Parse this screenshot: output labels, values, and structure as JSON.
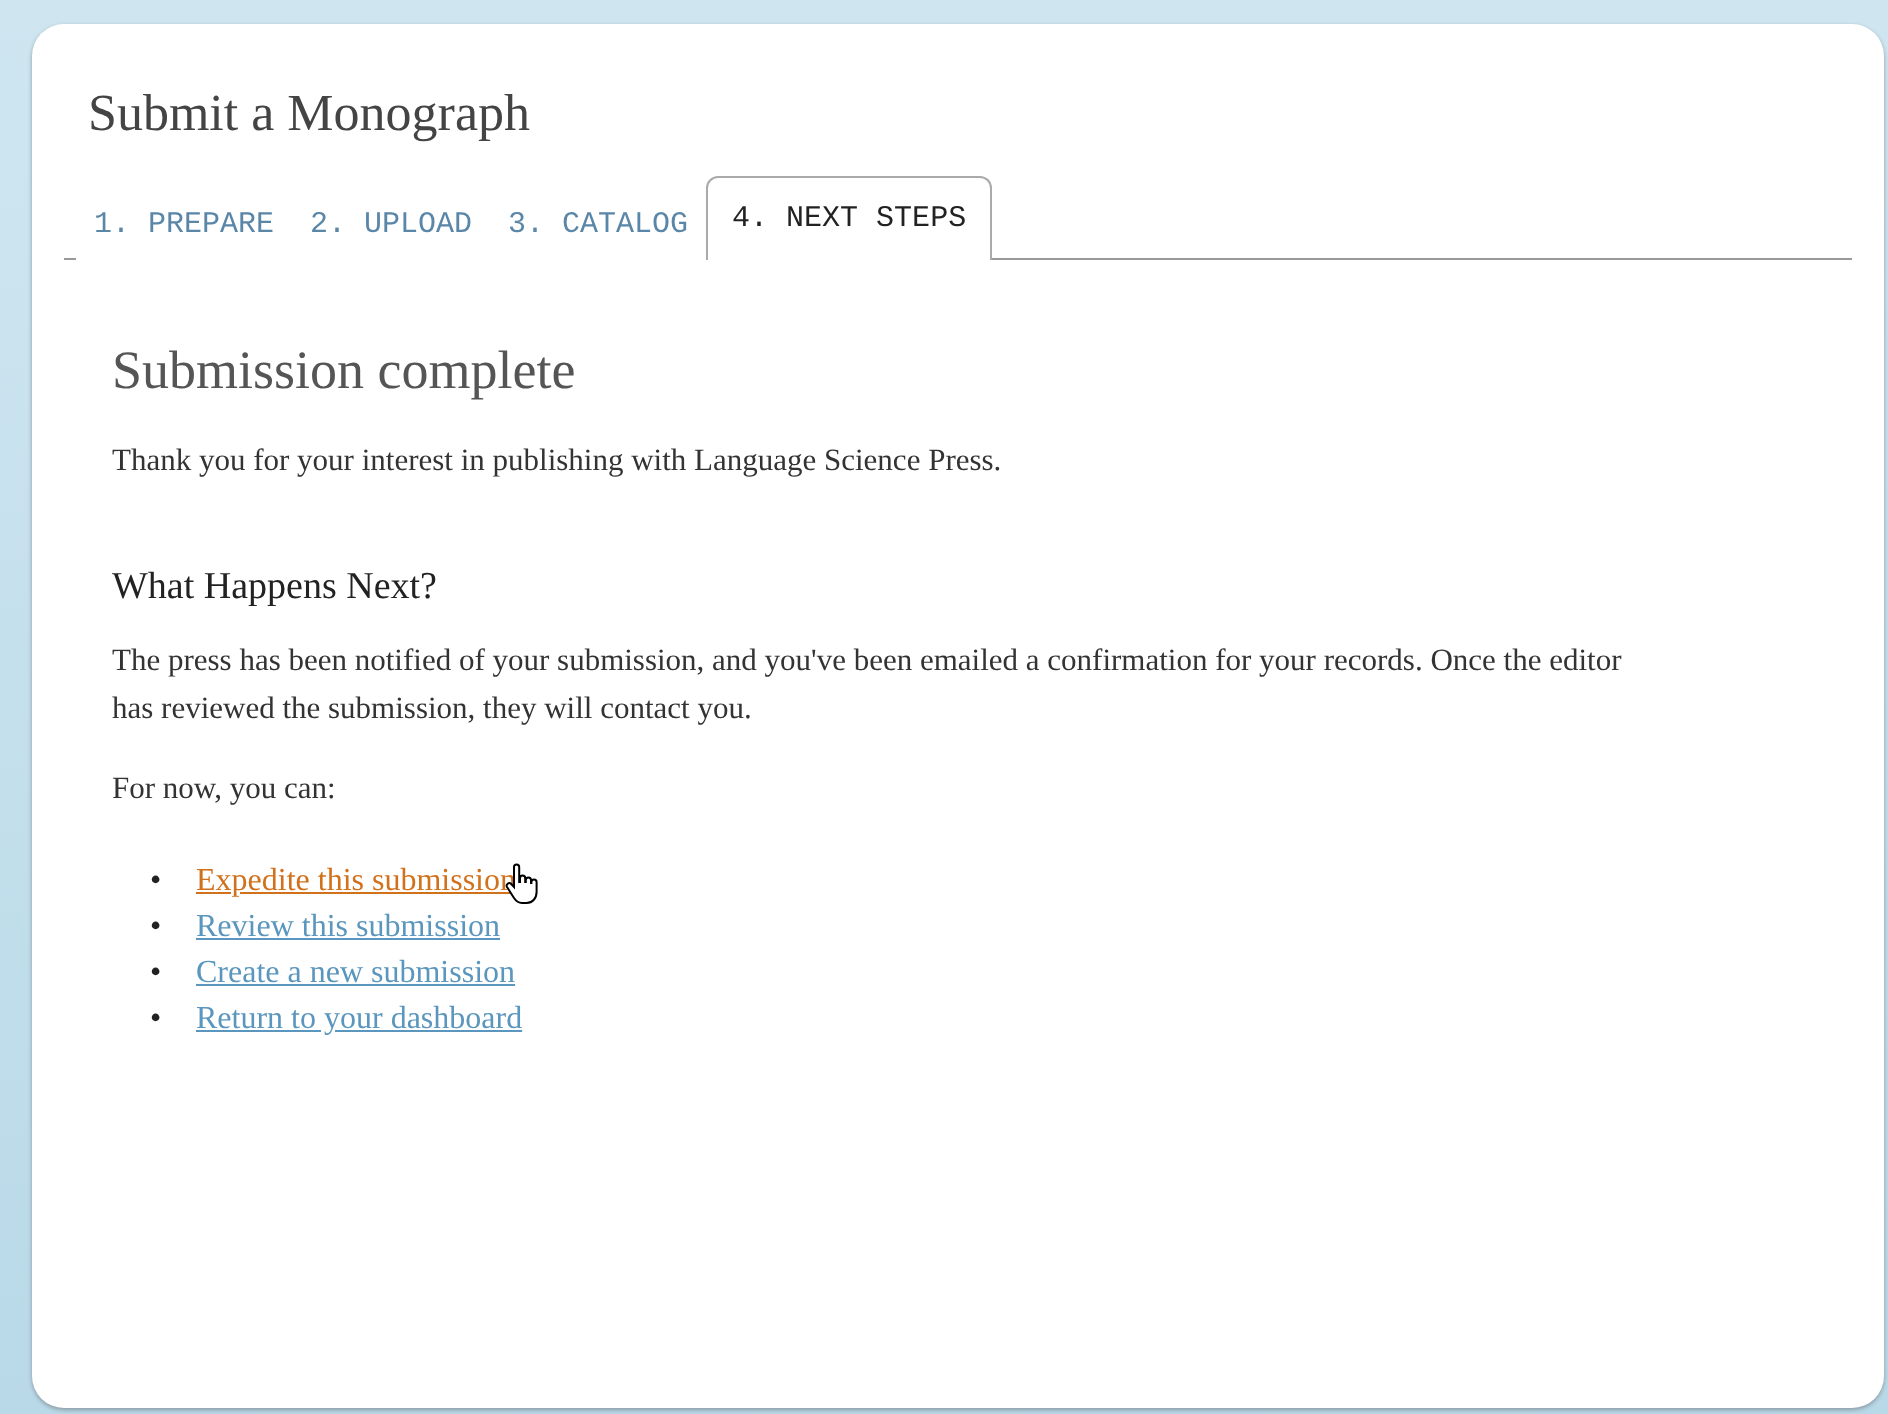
{
  "page": {
    "title": "Submit a Monograph"
  },
  "tabs": [
    {
      "label": "1. PREPARE",
      "selected": false
    },
    {
      "label": "2. UPLOAD",
      "selected": false
    },
    {
      "label": "3. CATALOG",
      "selected": false
    },
    {
      "label": "4. NEXT STEPS",
      "selected": true
    }
  ],
  "content": {
    "heading": "Submission complete",
    "intro": "Thank you for your interest in publishing with Language Science Press.",
    "subheading": "What Happens Next?",
    "paragraph": "The press has been notified of your submission, and you've been emailed a confirmation for your records. Once the editor has reviewed the submission, they will contact you.",
    "prompt": "For now, you can:",
    "links": [
      {
        "marker": "•",
        "label": "Expedite this submission",
        "hovered": true
      },
      {
        "marker": "•",
        "label": "Review this submission",
        "hovered": false
      },
      {
        "marker": "•",
        "label": "Create a new submission",
        "hovered": false
      },
      {
        "marker": "•",
        "label": "Return to your dashboard",
        "hovered": false
      }
    ]
  }
}
